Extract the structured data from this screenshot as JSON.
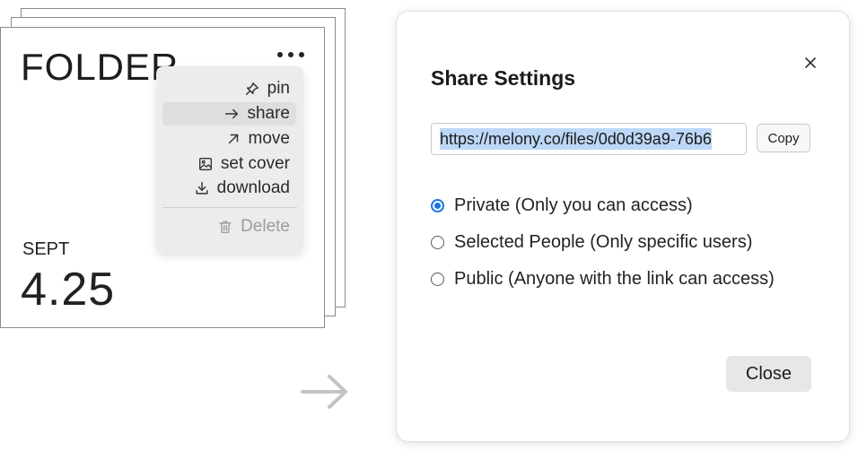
{
  "folder": {
    "title": "FOLDER",
    "date_month": "SEPT",
    "date_day": "4.25"
  },
  "menu": {
    "items": [
      {
        "label": "pin",
        "icon": "pin-icon"
      },
      {
        "label": "share",
        "icon": "arrow-right-icon"
      },
      {
        "label": "move",
        "icon": "arrow-up-right-icon"
      },
      {
        "label": "set cover",
        "icon": "image-icon"
      },
      {
        "label": "download",
        "icon": "download-icon"
      }
    ],
    "delete_label": "Delete",
    "delete_icon": "trash-icon"
  },
  "dialog": {
    "title": "Share Settings",
    "url": "https://melony.co/files/0d0d39a9-76b6",
    "copy_label": "Copy",
    "options": [
      {
        "label": "Private (Only you can access)",
        "checked": true
      },
      {
        "label": "Selected People (Only specific users)",
        "checked": false
      },
      {
        "label": "Public (Anyone with the link can access)",
        "checked": false
      }
    ],
    "close_label": "Close"
  },
  "colors": {
    "accent": "#1a73e8",
    "selection": "#bcd7f7"
  }
}
